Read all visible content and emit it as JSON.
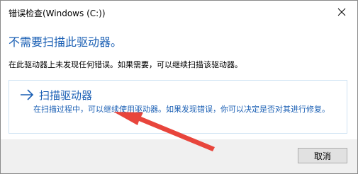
{
  "window": {
    "title": "错误检查(Windows (C:))"
  },
  "dialog": {
    "heading": "不需要扫描此驱动器。",
    "description": "在此驱动器上未发现任何错误。如果需要，可以继续扫描该驱动器。",
    "option": {
      "icon": "right-arrow-icon",
      "title": "扫描驱动器",
      "description": "在扫描过程中，可以继续使用驱动器。如果发现错误，你可以决定是否对其进行修复。"
    }
  },
  "footer": {
    "cancel_label": "取消"
  },
  "colors": {
    "accent": "#1a5fb4",
    "annotation_arrow": "#e8453c",
    "footer_bg": "#f0f0f0"
  }
}
